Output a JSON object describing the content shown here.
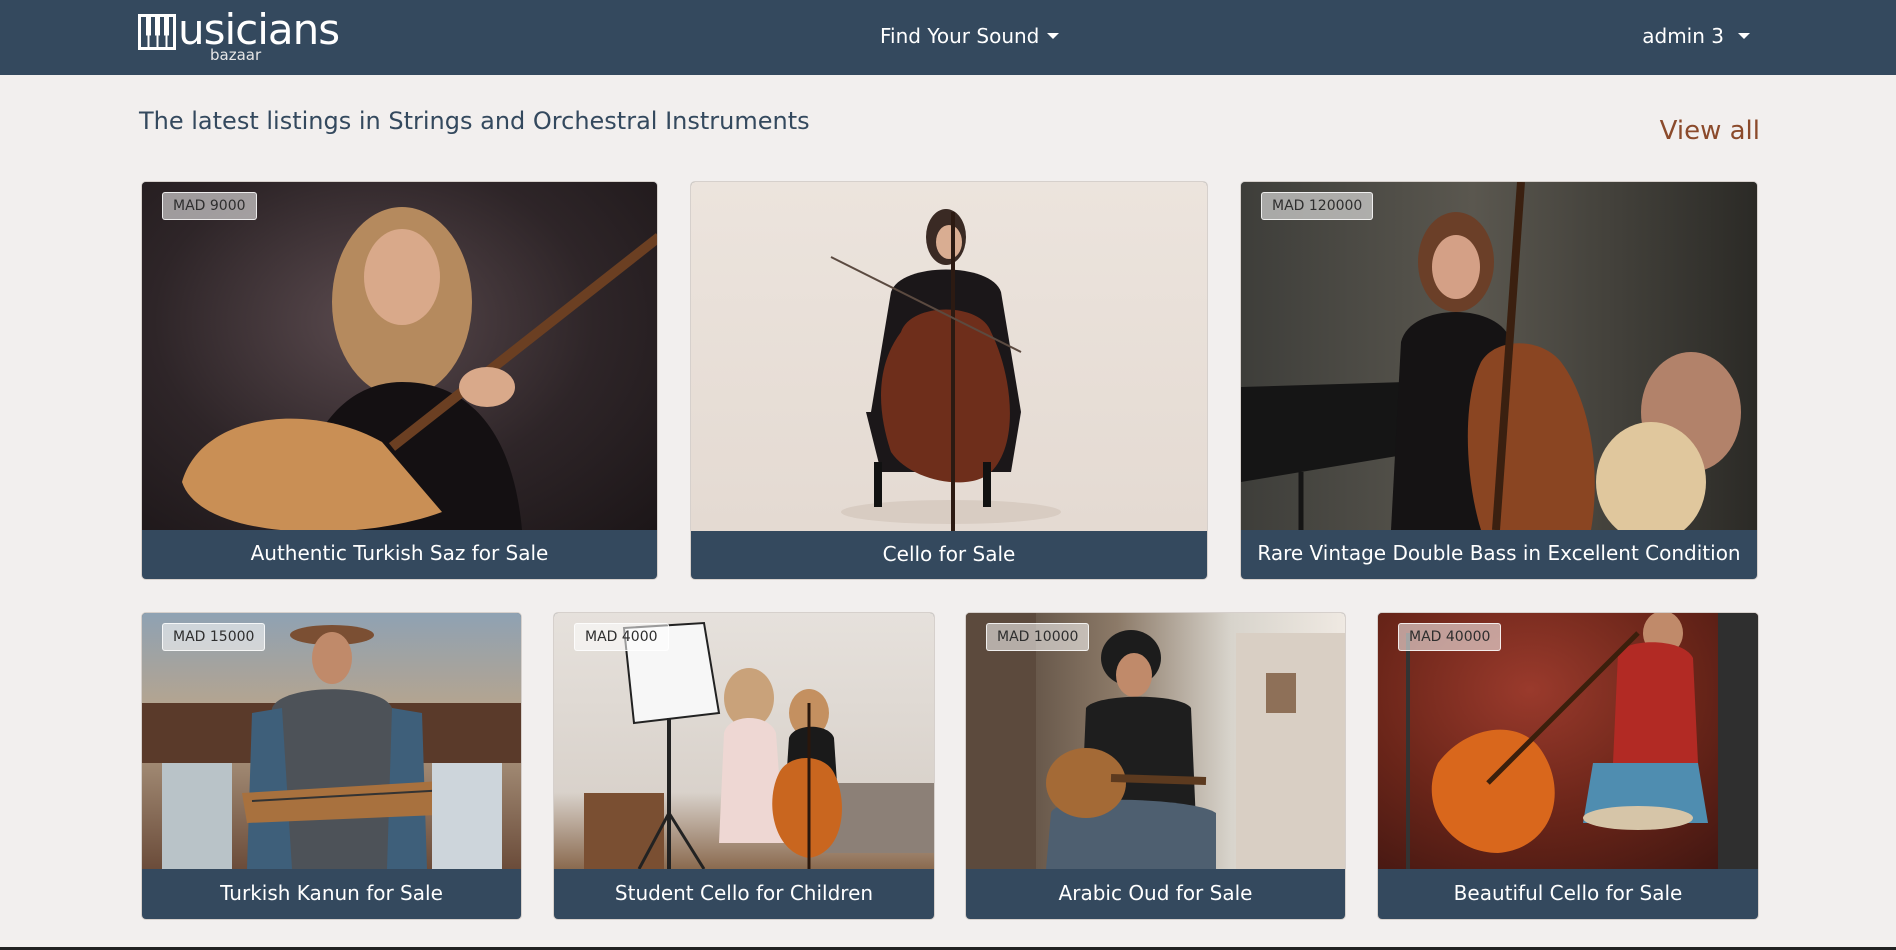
{
  "nav": {
    "brand_text": "usicians",
    "brand_sub": "bazaar",
    "menu_label": "Find Your Sound",
    "user_label": "admin 3"
  },
  "section": {
    "title": "The latest listings in Strings and Orchestral Instruments",
    "view_all": "View all"
  },
  "listings": [
    {
      "title": "Authentic Turkish Saz for Sale",
      "price": "MAD 9000"
    },
    {
      "title": "Cello for Sale",
      "price": ""
    },
    {
      "title": "Rare Vintage Double Bass in Excellent Condition",
      "price": "MAD 120000"
    },
    {
      "title": "Turkish Kanun for Sale",
      "price": "MAD 15000"
    },
    {
      "title": "Student Cello for Children",
      "price": "MAD 4000"
    },
    {
      "title": "Arabic Oud for Sale",
      "price": "MAD 10000"
    },
    {
      "title": "Beautiful Cello for Sale",
      "price": "MAD 40000"
    }
  ],
  "colors": {
    "navbar": "#34495e",
    "background": "#f2efee",
    "accent_link": "#8b4a2b"
  }
}
